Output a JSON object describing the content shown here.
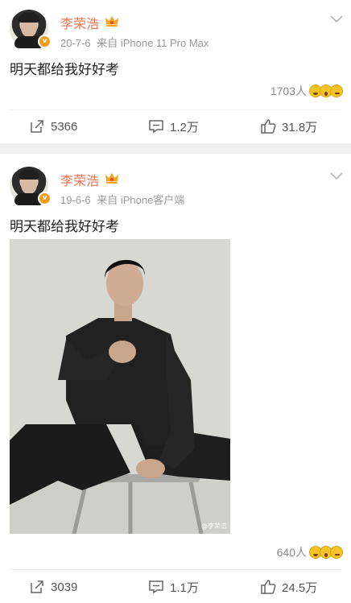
{
  "posts": [
    {
      "username": "李荣浩",
      "date": "20-7-6",
      "source": "来自 iPhone 11 Pro Max",
      "text": "明天都给我好好考",
      "likes_count": "1703人",
      "reposts": "5366",
      "comments": "1.2万",
      "likes": "31.8万"
    },
    {
      "username": "李荣浩",
      "date": "19-6-6",
      "source": "来自 iPhone客户端",
      "text": "明天都给我好好考",
      "likes_count": "640人",
      "reposts": "3039",
      "comments": "1.1万",
      "likes": "24.5万",
      "photo_watermark": "@李荣浩"
    }
  ],
  "colors": {
    "username": "#eb7350",
    "verified_badge": "#f79a1a",
    "meta_text": "#9a9a9a",
    "separator": "#f0f0f0"
  },
  "icons": {
    "verified": "verified-v-icon",
    "vip": "crown-icon",
    "menu": "chevron-down-icon",
    "repost": "share-icon",
    "comment": "comment-icon",
    "like": "thumbs-up-icon",
    "reactions": [
      "laughing-emoji-icon",
      "surprised-emoji-icon",
      "smirk-emoji-icon"
    ]
  }
}
